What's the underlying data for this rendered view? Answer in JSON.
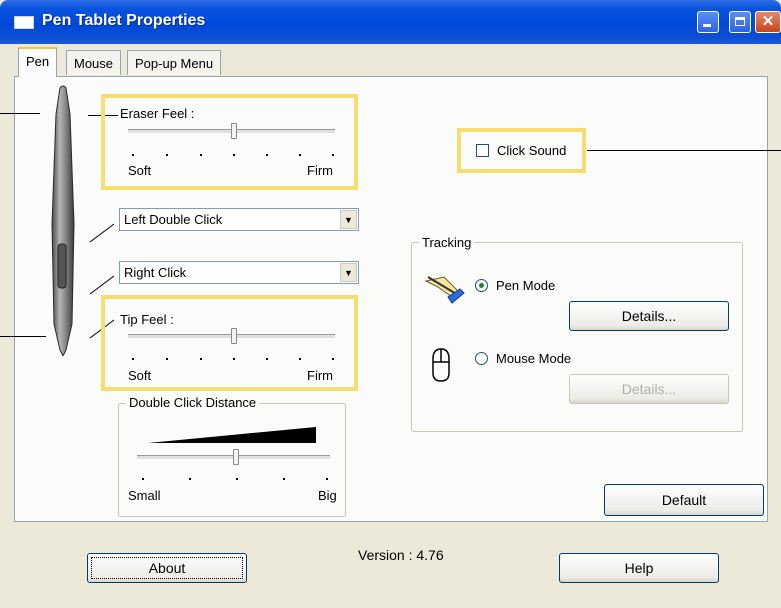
{
  "window": {
    "title": "Pen Tablet Properties"
  },
  "tabs": [
    {
      "label": "Pen",
      "active": true
    },
    {
      "label": "Mouse",
      "active": false
    },
    {
      "label": "Pop-up Menu",
      "active": false
    }
  ],
  "eraser_feel": {
    "label": "Eraser Feel :",
    "min_label": "Soft",
    "max_label": "Firm",
    "level": 0.5
  },
  "side_button_upper": {
    "value": "Left Double Click"
  },
  "side_button_lower": {
    "value": "Right Click"
  },
  "tip_feel": {
    "label": "Tip Feel :",
    "min_label": "Soft",
    "max_label": "Firm",
    "level": 0.5
  },
  "double_click_distance": {
    "label": "Double Click Distance",
    "min_label": "Small",
    "max_label": "Big",
    "level": 0.5
  },
  "click_sound": {
    "label": "Click Sound",
    "checked": false
  },
  "tracking": {
    "label": "Tracking",
    "pen_mode": {
      "label": "Pen Mode",
      "selected": true
    },
    "pen_details": "Details...",
    "mouse_mode": {
      "label": "Mouse Mode",
      "selected": false
    },
    "mouse_details": "Details..."
  },
  "buttons": {
    "default": "Default",
    "about": "About",
    "help": "Help"
  },
  "version": "Version : 4.76",
  "colors": {
    "highlight": "#f7dc6f",
    "titlebar": "#0048d8",
    "face": "#ece9d8"
  },
  "icons": [
    "window-icon",
    "minimize-icon",
    "maximize-icon",
    "close-icon",
    "pen-illustration",
    "pen-mode-icon",
    "mouse-mode-icon",
    "dropdown-arrow-icon"
  ]
}
